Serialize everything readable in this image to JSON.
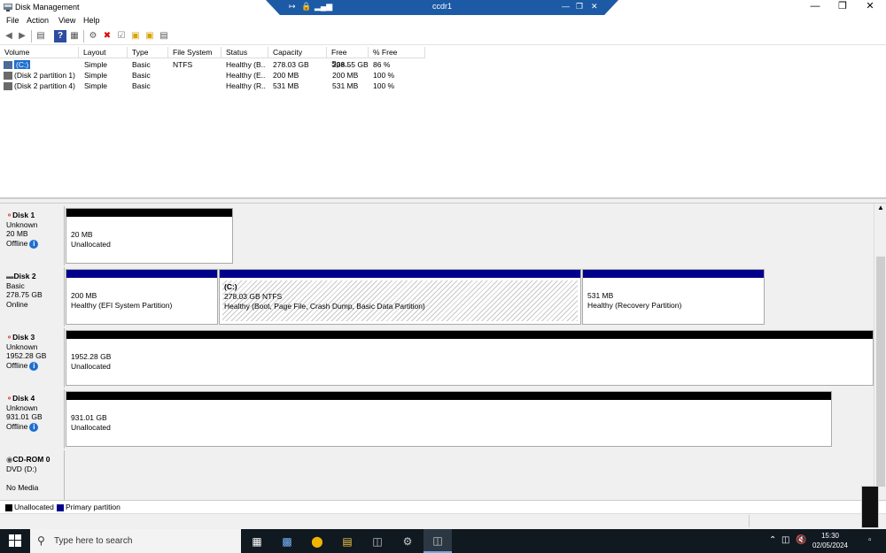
{
  "window": {
    "title": "Disk Management"
  },
  "remote_banner": {
    "host": "ccdr1"
  },
  "menu": [
    "File",
    "Action",
    "View",
    "Help"
  ],
  "volume_table": {
    "headers": [
      "Volume",
      "Layout",
      "Type",
      "File System",
      "Status",
      "Capacity",
      "Free Spa...",
      "% Free"
    ],
    "rows": [
      [
        "(C:)",
        "Simple",
        "Basic",
        "NTFS",
        "Healthy (B...",
        "278.03 GB",
        "238.55 GB",
        "86 %"
      ],
      [
        "(Disk 2 partition 1)",
        "Simple",
        "Basic",
        "",
        "Healthy (E...",
        "200 MB",
        "200 MB",
        "100 %"
      ],
      [
        "(Disk 2 partition 4)",
        "Simple",
        "Basic",
        "",
        "Healthy (R...",
        "531 MB",
        "531 MB",
        "100 %"
      ]
    ]
  },
  "disks": [
    {
      "name": "Disk 1",
      "type": "Unknown",
      "size": "20 MB",
      "state": "Offline",
      "partitions": [
        {
          "size": "20 MB",
          "status": "Unallocated"
        }
      ]
    },
    {
      "name": "Disk 2",
      "type": "Basic",
      "size": "278.75 GB",
      "state": "Online",
      "partitions": [
        {
          "size": "200 MB",
          "status": "Healthy (EFI System Partition)"
        },
        {
          "label": "(C:)",
          "size": "278.03 GB NTFS",
          "status": "Healthy (Boot, Page File, Crash Dump, Basic Data Partition)"
        },
        {
          "size": "531 MB",
          "status": "Healthy (Recovery Partition)"
        }
      ]
    },
    {
      "name": "Disk 3",
      "type": "Unknown",
      "size": "1952.28 GB",
      "state": "Offline",
      "partitions": [
        {
          "size": "1952.28 GB",
          "status": "Unallocated"
        }
      ]
    },
    {
      "name": "Disk 4",
      "type": "Unknown",
      "size": "931.01 GB",
      "state": "Offline",
      "partitions": [
        {
          "size": "931.01 GB",
          "status": "Unallocated"
        }
      ]
    },
    {
      "name": "CD-ROM 0",
      "type": "DVD (D:)",
      "size": "",
      "state": "No Media",
      "partitions": []
    }
  ],
  "legend": {
    "unallocated": "Unallocated",
    "primary": "Primary partition"
  },
  "colors": {
    "unallocated": "#000000",
    "primary": "#00008b",
    "selection": "#1e6fd0",
    "taskbar": "#101820"
  },
  "taskbar": {
    "search_placeholder": "Type here to search",
    "time": "15:30",
    "date": "02/05/2024"
  }
}
